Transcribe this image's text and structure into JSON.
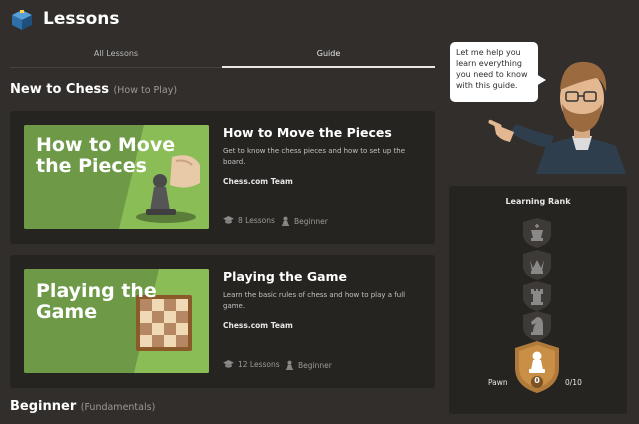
{
  "header": {
    "title": "Lessons"
  },
  "tabs": [
    {
      "label": "All Lessons",
      "active": false
    },
    {
      "label": "Guide",
      "active": true
    }
  ],
  "sections": [
    {
      "title": "New to Chess",
      "subtitle": "(How to Play)"
    },
    {
      "title": "Beginner",
      "subtitle": "(Fundamentals)"
    }
  ],
  "courses": [
    {
      "thumb_title_line1": "How to Move",
      "thumb_title_line2": "the Pieces",
      "title": "How to Move the Pieces",
      "description": "Get to know the chess pieces and how to set up the board.",
      "author": "Chess.com Team",
      "lessons": "8 Lessons",
      "level": "Beginner"
    },
    {
      "thumb_title_line1": "Playing the",
      "thumb_title_line2": "Game",
      "title": "Playing the Game",
      "description": "Learn the basic rules of chess and how to play a full game.",
      "author": "Chess.com Team",
      "lessons": "12 Lessons",
      "level": "Beginner"
    }
  ],
  "coach": {
    "speech": "Let me help you learn everything you need to know with this guide."
  },
  "learning_rank": {
    "title": "Learning Rank",
    "current_rank": "Pawn",
    "current_value": "0",
    "progress": "0/10"
  },
  "colors": {
    "accent_green": "#769656",
    "bronze": "#b07a3a",
    "panel": "#262421",
    "background": "#312e2b"
  }
}
